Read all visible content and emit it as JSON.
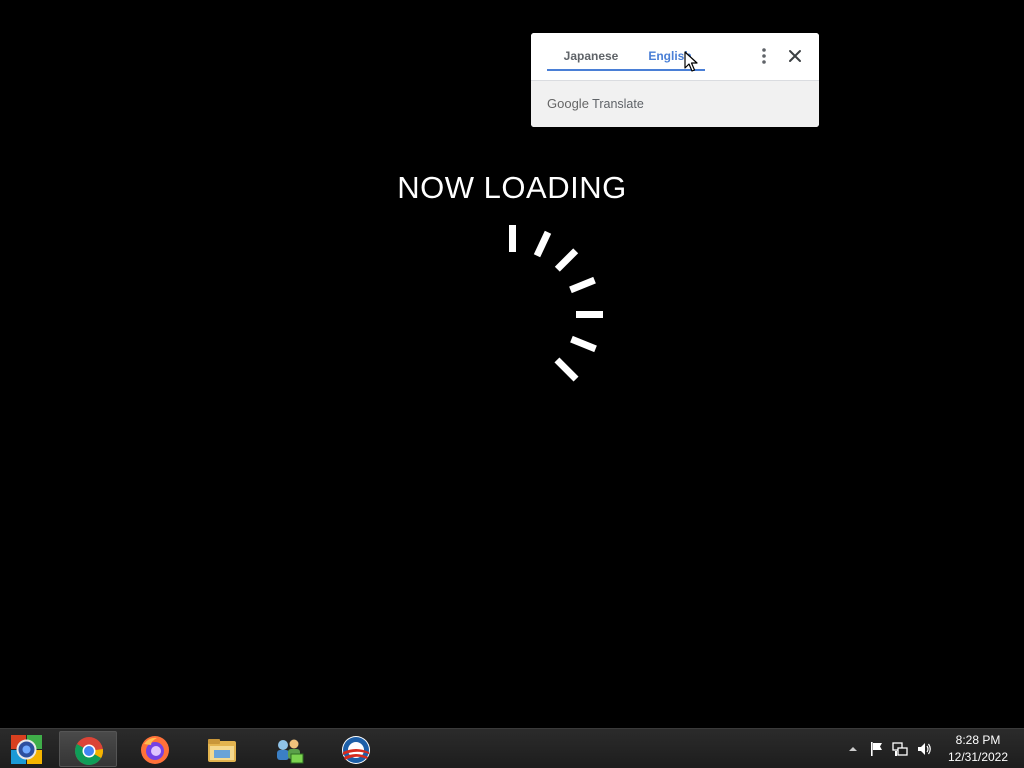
{
  "loading": {
    "title": "NOW LOADING"
  },
  "translate_popup": {
    "tabs": [
      {
        "label": "Japanese",
        "selected": false
      },
      {
        "label": "English",
        "selected": true
      }
    ],
    "brand_google": "Google",
    "brand_translate": "Translate",
    "more_icon": "more-vertical-icon",
    "close_icon": "close-icon",
    "accent_color": "#4a7fd6"
  },
  "taskbar": {
    "start_icon": "windows-start-icon",
    "apps": [
      {
        "name": "chrome-icon",
        "active": true
      },
      {
        "name": "firefox-icon",
        "active": false
      },
      {
        "name": "file-explorer-icon",
        "active": false
      },
      {
        "name": "network-users-icon",
        "active": false
      },
      {
        "name": "obama-logo-icon",
        "active": false
      }
    ],
    "tray": {
      "icons": [
        "show-hidden-icons-arrow",
        "action-center-flag-icon",
        "network-icon",
        "volume-icon"
      ],
      "time": "8:28 PM",
      "date": "12/31/2022"
    }
  }
}
